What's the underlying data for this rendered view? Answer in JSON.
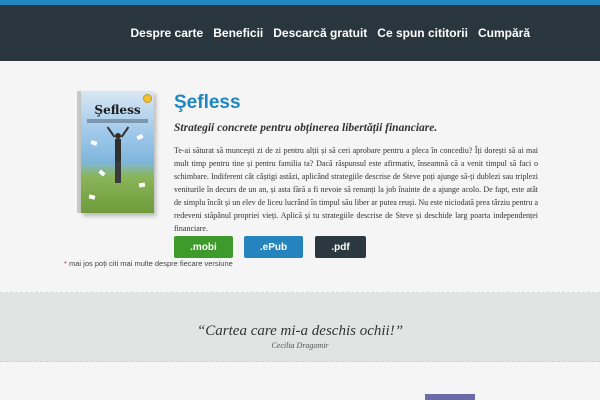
{
  "nav": {
    "items": [
      {
        "label": "Despre carte"
      },
      {
        "label": "Beneficii"
      },
      {
        "label": "Descarcă gratuit"
      },
      {
        "label": "Ce spun cititorii"
      },
      {
        "label": "Cumpără"
      }
    ]
  },
  "book": {
    "cover_title": "Şefless"
  },
  "hero": {
    "title": "Şefless",
    "subtitle": "Strategii concrete pentru obținerea libertății financiare.",
    "description": "Te-ai săturat să muncești zi de zi pentru alții și să ceri aprobare pentru a pleca în concediu? Îți dorești să ai mai mult timp pentru tine și pentru familia ta? Dacă răspunsul este afirmativ, înseamnă că a venit timpul să faci o schimbare. Indiferent cât câștigi astăzi, aplicând strategiile descrise de Steve poți ajunge să-ți dublezi sau triplezi veniturile în decurs de un an, și asta fără a fi nevoie să renunți la job înainte de a ajunge acolo. De fapt, este atât de simplu încât și un elev de liceu lucrând în timpul său liber ar putea reuși. Nu este niciodată prea târziu pentru a redeveni stăpânul propriei vieți. Aplică și tu strategiile descrise de Steve și deschide larg poarta independenței financiare."
  },
  "downloads": {
    "mobi": {
      "label": ".mobi",
      "color": "#3e9a2a"
    },
    "epub": {
      "label": ".ePub",
      "color": "#2584be"
    },
    "pdf": {
      "label": ".pdf",
      "color": "#2c3840"
    }
  },
  "note": {
    "star": "*",
    "text": " mai jos poți citi mai multe despre fiecare versiune"
  },
  "testimonial": {
    "quote": "“Cartea care mi-a deschis ochii!”",
    "author": "Cecilia Dragomir"
  },
  "colors": {
    "accent": "#1f86c0",
    "header_bg": "#2a363d"
  }
}
